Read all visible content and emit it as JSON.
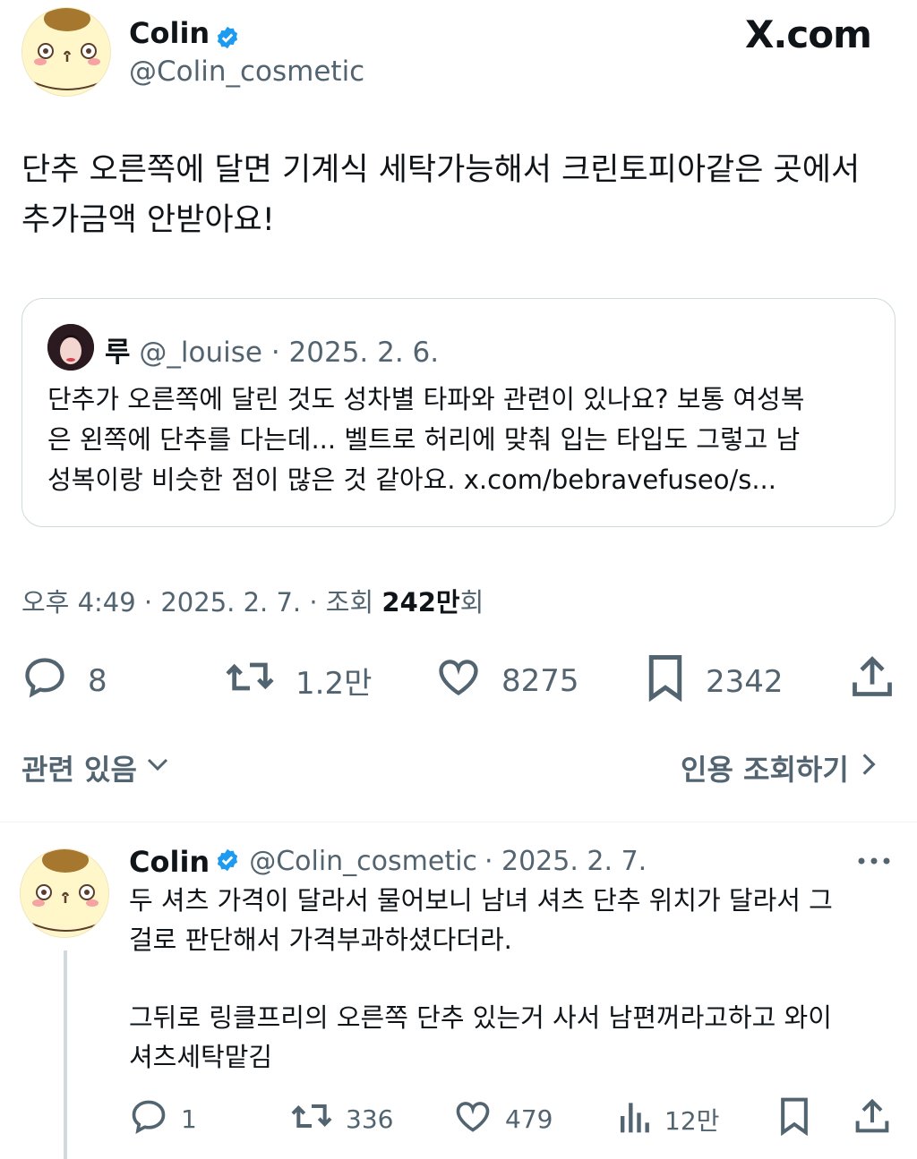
{
  "brand": "X.com",
  "tweet": {
    "author_name": "Colin",
    "author_handle": "@Colin_cosmetic",
    "text_line1": "단추 오른쪽에 달면 기계식 세탁가능해서 크린토피아같은 곳에서",
    "text_line2": "추가금액 안받아요!",
    "quote": {
      "author_name": "루",
      "author_handle": "@_louise",
      "date": "· 2025. 2. 6.",
      "line1": "단추가 오른쪽에 달린 것도 성차별 타파와 관련이 있나요? 보통 여성복",
      "line2": "은 왼쪽에 단추를 다는데... 벨트로 허리에 맞춰 입는 타입도 그렇고 남",
      "line3": "성복이랑 비슷한 점이 많은 것 같아요. x.com/bebravefuseo/s..."
    },
    "meta": {
      "time_date": "오후 4:49 · 2025. 2. 7. · 조회 ",
      "views_bold": "242만",
      "views_suffix": "회"
    },
    "actions": {
      "replies": "8",
      "retweets": "1.2만",
      "likes": "8275",
      "bookmarks": "2342"
    },
    "related_label": "관련 있음",
    "quotes_label": "인용 조회하기"
  },
  "reply": {
    "author_name": "Colin",
    "author_handle": "@Colin_cosmetic",
    "date": "· 2025. 2. 7.",
    "line1": "두 셔츠 가격이 달라서 물어보니 남녀 셔츠 단추 위치가 달라서 그",
    "line2": "걸로 판단해서 가격부과하셨다더라.",
    "line3": "그뒤로 링클프리의 오른쪽 단추 있는거 사서 남편꺼라고하고 와이",
    "line4": "셔츠세탁맡김",
    "actions": {
      "replies": "1",
      "retweets": "336",
      "likes": "479",
      "views": "12만"
    }
  },
  "colors": {
    "verified": "#1d9bf0",
    "muted": "#536471",
    "border": "#cfd9de",
    "avatar_bg": "#fff7c9"
  },
  "icons": [
    "verified-badge-icon",
    "reply-icon",
    "retweet-icon",
    "like-icon",
    "bookmark-icon",
    "share-icon",
    "views-icon",
    "more-icon",
    "chevron-down-icon",
    "chevron-right-icon"
  ]
}
